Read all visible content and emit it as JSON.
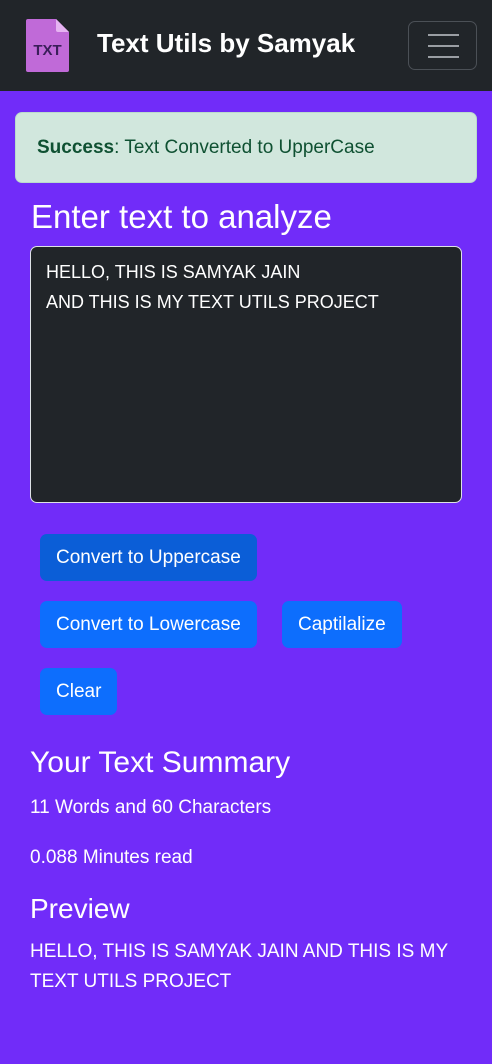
{
  "navbar": {
    "icon_text": "TXT",
    "brand": "Text Utils by Samyak",
    "toggler_icon": "hamburger-menu-icon"
  },
  "alert": {
    "type": "Success",
    "separator": ": ",
    "message": "Text Converted to UpperCase",
    "bg_color": "#d1e7dd",
    "text_color": "#0f5132"
  },
  "form": {
    "heading": "Enter text to analyze",
    "textarea_value": "HELLO, THIS IS SAMYAK JAIN\nAND THIS IS MY TEXT UTILS PROJECT"
  },
  "buttons": {
    "uppercase": "Convert to Uppercase",
    "lowercase": "Convert to Lowercase",
    "capitalize": "Captilalize",
    "clear": "Clear"
  },
  "summary": {
    "title": "Your Text Summary",
    "counts": "11 Words and 60 Characters",
    "read_time": "0.088 Minutes read"
  },
  "preview": {
    "title": "Preview",
    "text": "HELLO, THIS IS SAMYAK JAIN AND THIS IS MY TEXT UTILS PROJECT"
  },
  "colors": {
    "page_bg": "#712cf9",
    "navbar_bg": "#212529",
    "button_bg": "#0d6efd"
  }
}
